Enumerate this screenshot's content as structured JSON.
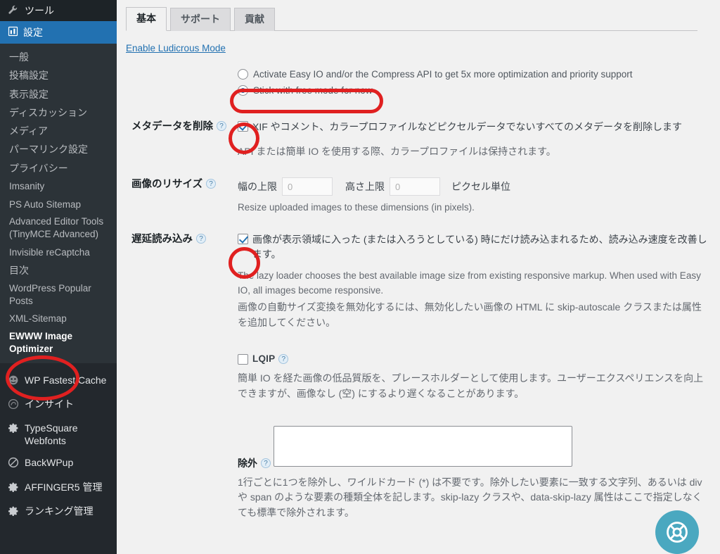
{
  "sidebar": {
    "top_item": {
      "label": "ツール",
      "icon": "wrench-icon"
    },
    "current": {
      "label": "設定",
      "icon": "settings-sliders-icon"
    },
    "submenu": [
      {
        "label": "一般"
      },
      {
        "label": "投稿設定"
      },
      {
        "label": "表示設定"
      },
      {
        "label": "ディスカッション"
      },
      {
        "label": "メディア"
      },
      {
        "label": "パーマリンク設定"
      },
      {
        "label": "プライバシー"
      },
      {
        "label": "Imsanity"
      },
      {
        "label": "PS Auto Sitemap"
      },
      {
        "label": "Advanced Editor Tools (TinyMCE Advanced)"
      },
      {
        "label": "Invisible reCaptcha"
      },
      {
        "label": "目次"
      },
      {
        "label": "WordPress Popular Posts"
      },
      {
        "label": "XML-Sitemap"
      },
      {
        "label": "EWWW Image Optimizer"
      }
    ],
    "plugins": [
      {
        "label": "WP Fastest Cache",
        "icon": "cheetah-icon"
      },
      {
        "label": "インサイト",
        "icon": "insight-icon"
      },
      {
        "label": "TypeSquare Webfonts",
        "icon": "gear-icon"
      },
      {
        "label": "BackWPup",
        "icon": "backwpup-icon"
      },
      {
        "label": "AFFINGER5 管理",
        "icon": "gear-icon"
      },
      {
        "label": "ランキング管理",
        "icon": "gear-icon"
      }
    ]
  },
  "tabs": [
    {
      "label": "基本",
      "active": true
    },
    {
      "label": "サポート",
      "active": false
    },
    {
      "label": "貢献",
      "active": false
    }
  ],
  "ludicrous_link": "Enable Ludicrous Mode",
  "mode": {
    "option_activate": "Activate Easy IO and/or the Compress API to get 5x more optimization and priority support",
    "option_free": "Stick with free mode for now"
  },
  "metadata": {
    "label": "メタデータを削除",
    "checkbox_text": "XIF やコメント、カラープロファイルなどピクセルデータでないすべてのメタデータを削除します",
    "description": "API または簡単 IO を使用する際、カラープロファイルは保持されます。"
  },
  "resize": {
    "label": "画像のリサイズ",
    "width_label": "幅の上限",
    "width_value": "0",
    "height_label": "高さ上限",
    "height_value": "0",
    "unit_label": "ピクセル単位",
    "description": "Resize uploaded images to these dimensions (in pixels)."
  },
  "lazyload": {
    "label": "遅延読み込み",
    "checkbox_text": "画像が表示領域に入った (または入ろうとしている) 時にだけ読み込まれるため、読み込み速度を改善します。",
    "description_en": "The lazy loader chooses the best available image size from existing responsive markup. When used with Easy IO, all images become responsive.",
    "description_jp": "画像の自動サイズ変換を無効化するには、無効化したい画像の HTML に skip-autoscale クラスまたは属性を追加してください。"
  },
  "lqip": {
    "label": "LQIP",
    "description": "簡単 IO を経た画像の低品質版を、プレースホルダーとして使用します。ユーザーエクスペリエンスを向上できますが、画像なし (空) にするより遅くなることがあります。"
  },
  "exclusions": {
    "label": "除外",
    "value": "",
    "description": "1行ごとに1つを除外し、ワイルドカード (*) は不要です。除外したい要素に一致する文字列、あるいは div や span のような要素の種類全体を記します。skip-lazy クラスや、data-skip-lazy 属性はここで指定しなくても標準で除外されます。"
  },
  "help_fab": {
    "icon": "lifebuoy-icon"
  },
  "colors": {
    "sidebar_bg": "#23282d",
    "submenu_bg": "#2c3338",
    "accent_blue": "#2271b1",
    "annotation_red": "#e02020",
    "fab_teal": "#4aa8c0"
  }
}
